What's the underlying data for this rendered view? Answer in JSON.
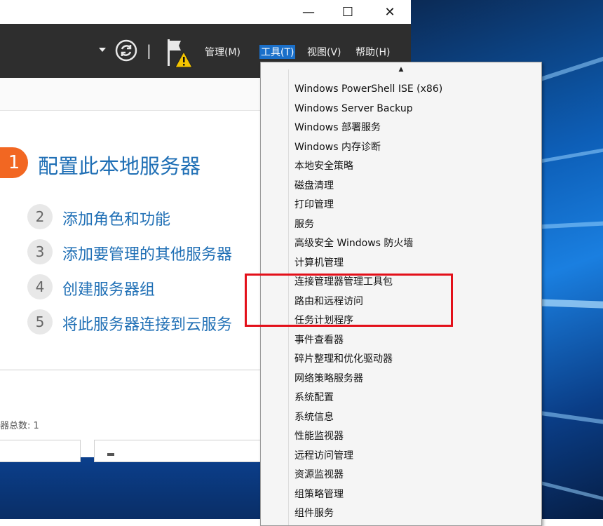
{
  "titlebar": {
    "minimize_glyph": "—",
    "maximize_glyph": "☐",
    "close_glyph": "✕"
  },
  "toolbar": {
    "menus": [
      "管理(M)",
      "工具(T)",
      "视图(V)",
      "帮助(H)"
    ],
    "active_menu": "工具(T)",
    "separator": "|"
  },
  "welcome": {
    "primary_step": {
      "number": "1",
      "label": "配置此本地服务器"
    },
    "steps": [
      {
        "number": "2",
        "label": "添加角色和功能"
      },
      {
        "number": "3",
        "label": "添加要管理的其他服务器"
      },
      {
        "number": "4",
        "label": "创建服务器组"
      },
      {
        "number": "5",
        "label": "将此服务器连接到云服务"
      }
    ]
  },
  "status": {
    "server_count": "器总数: 1"
  },
  "tools_menu": {
    "items": [
      "Windows PowerShell ISE (x86)",
      "Windows Server Backup",
      "Windows 部署服务",
      "Windows 内存诊断",
      "本地安全策略",
      "磁盘清理",
      "打印管理",
      "服务",
      "高级安全 Windows 防火墙",
      "计算机管理",
      "连接管理器管理工具包",
      "路由和远程访问",
      "任务计划程序",
      "事件查看器",
      "碎片整理和优化驱动器",
      "网络策略服务器",
      "系统配置",
      "系统信息",
      "性能监视器",
      "远程访问管理",
      "资源监视器",
      "组策略管理",
      "组件服务"
    ]
  },
  "colors": {
    "toolbar_bg": "#2e2e2e",
    "active_menu_bg": "#1a6fc9",
    "link_blue": "#1f6fb5",
    "primary_step_orange": "#f26722",
    "annotation_red": "#e3101a"
  }
}
